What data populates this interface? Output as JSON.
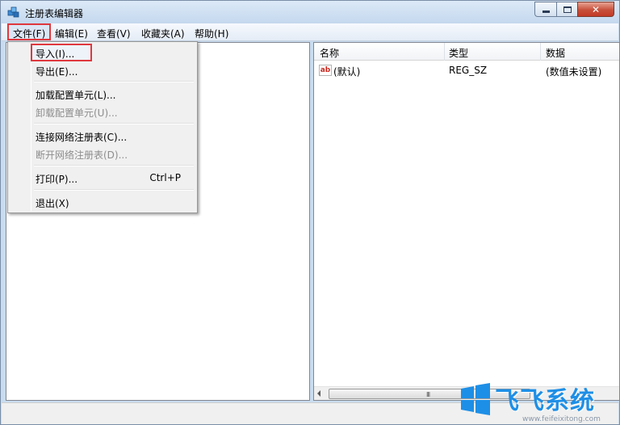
{
  "window": {
    "title": "注册表编辑器"
  },
  "menubar": {
    "items": [
      "文件(F)",
      "编辑(E)",
      "查看(V)",
      "收藏夹(A)",
      "帮助(H)"
    ]
  },
  "file_menu": {
    "items": [
      {
        "label": "导入(I)...",
        "enabled": true
      },
      {
        "label": "导出(E)...",
        "enabled": true
      },
      {
        "label": "加载配置单元(L)...",
        "enabled": true
      },
      {
        "label": "卸载配置单元(U)...",
        "enabled": false
      },
      {
        "label": "连接网络注册表(C)...",
        "enabled": true
      },
      {
        "label": "断开网络注册表(D)...",
        "enabled": false
      },
      {
        "label": "打印(P)...",
        "enabled": true,
        "shortcut": "Ctrl+P"
      },
      {
        "label": "退出(X)",
        "enabled": true
      }
    ]
  },
  "list": {
    "columns": [
      "名称",
      "类型",
      "数据"
    ],
    "rows": [
      {
        "name": "(默认)",
        "type": "REG_SZ",
        "data": "(数值未设置)"
      }
    ],
    "scroll_grip": "III"
  },
  "watermark": {
    "title": "飞飞系统",
    "url": "www.feifeixitong.com"
  },
  "colors": {
    "highlight_border": "#e0383e",
    "watermark_blue": "#1e8fe6"
  }
}
